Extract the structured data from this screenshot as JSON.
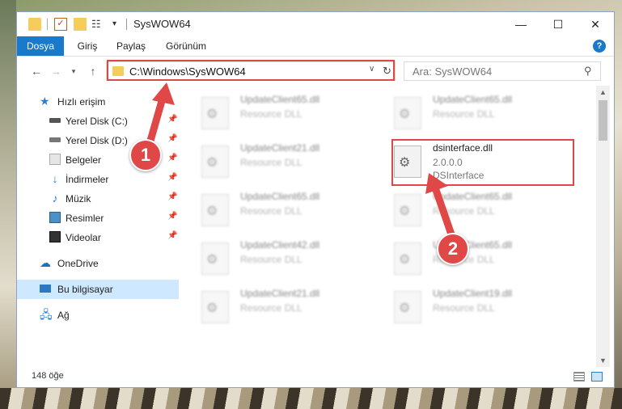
{
  "window": {
    "title": "SysWOW64",
    "controls": {
      "minimize": "—",
      "maximize": "☐",
      "close": "✕"
    }
  },
  "ribbon": {
    "tabs": [
      "Dosya",
      "Giriş",
      "Paylaş",
      "Görünüm"
    ],
    "help": "?"
  },
  "address_bar": {
    "path": "C:\\Windows\\SysWOW64"
  },
  "search": {
    "placeholder": "Ara: SysWOW64"
  },
  "sidebar": {
    "items": [
      {
        "label": "Hızlı erişim",
        "icon": "star-icon"
      },
      {
        "label": "Yerel Disk (C:)",
        "icon": "drive-icon",
        "pinned": true
      },
      {
        "label": "Yerel Disk (D:)",
        "icon": "drive-icon",
        "pinned": true
      },
      {
        "label": "Belgeler",
        "icon": "documents-icon",
        "pinned": true
      },
      {
        "label": "İndirmeler",
        "icon": "download-icon",
        "pinned": true
      },
      {
        "label": "Müzik",
        "icon": "music-icon",
        "pinned": true
      },
      {
        "label": "Resimler",
        "icon": "pictures-icon",
        "pinned": true
      },
      {
        "label": "Videolar",
        "icon": "videos-icon",
        "pinned": true
      },
      {
        "label": "OneDrive",
        "icon": "onedrive-icon"
      },
      {
        "label": "Bu bilgisayar",
        "icon": "computer-icon",
        "selected": true
      },
      {
        "label": "Ağ",
        "icon": "network-icon"
      }
    ]
  },
  "files": [
    {
      "name": "UpdateClient65.dll",
      "desc": "Resource DLL"
    },
    {
      "name": "UpdateClient65.dll",
      "desc": "Resource DLL"
    },
    {
      "name": "UpdateClient21.dll",
      "desc": "Resource DLL"
    },
    {
      "name": "dsinterface.dll",
      "version": "2.0.0.0",
      "desc": "DSInterface"
    },
    {
      "name": "UpdateClient65.dll",
      "desc": "Resource DLL"
    },
    {
      "name": "UpdateClient65.dll",
      "desc": "Resource DLL"
    },
    {
      "name": "UpdateClient42.dll",
      "desc": "Resource DLL"
    },
    {
      "name": "UpdateClient65.dll",
      "desc": "Resource DLL"
    },
    {
      "name": "UpdateClient21.dll",
      "desc": "Resource DLL"
    },
    {
      "name": "UpdateClient19.dll",
      "desc": "Resource DLL"
    }
  ],
  "status": {
    "count": "148 öğe"
  },
  "callouts": [
    "1",
    "2"
  ],
  "colors": {
    "accent": "#1979ca",
    "highlight": "#e04848",
    "selected_bg": "#cde8ff"
  }
}
